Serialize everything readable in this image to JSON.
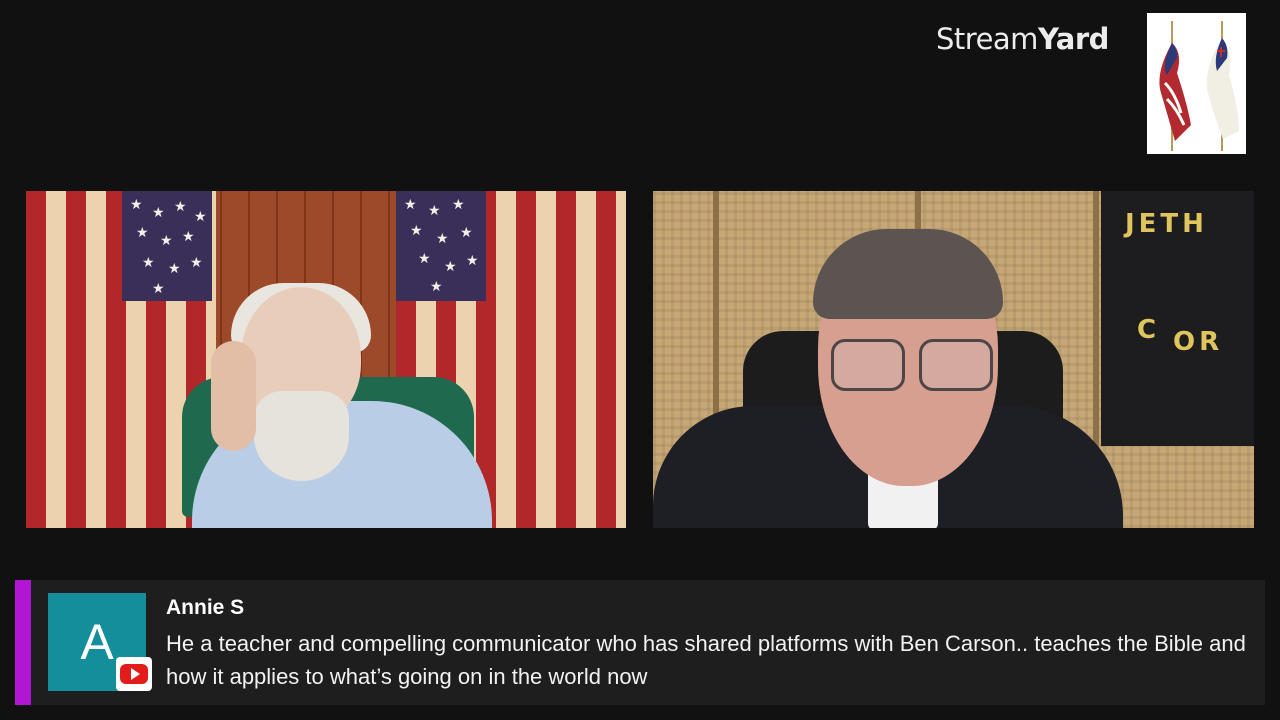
{
  "branding": {
    "name_part1": "Stream",
    "name_part2": "Yard"
  },
  "logo": {
    "description_icon": "flags-icon"
  },
  "participants": [
    {
      "position": "left",
      "visual": "elderly man with white beard in front of flags"
    },
    {
      "position": "right",
      "visual": "man with glasses in front of wicker screen"
    }
  ],
  "background_board": {
    "visible_text_line1": "JETH",
    "visible_text_line2": "C",
    "visible_text_line3": "OR"
  },
  "comment": {
    "avatar_letter": "A",
    "author": "Annie S",
    "text": "He a teacher and compelling communicator who has shared platforms with Ben Carson.. teaches the Bible and how it applies to what’s going on in the world now",
    "platform_icon": "youtube-icon"
  },
  "colors": {
    "background": "#111112",
    "banner": "#1e1e1f",
    "accent": "#b116d2",
    "avatar": "#148e9a",
    "youtube_red": "#e21b1b"
  }
}
